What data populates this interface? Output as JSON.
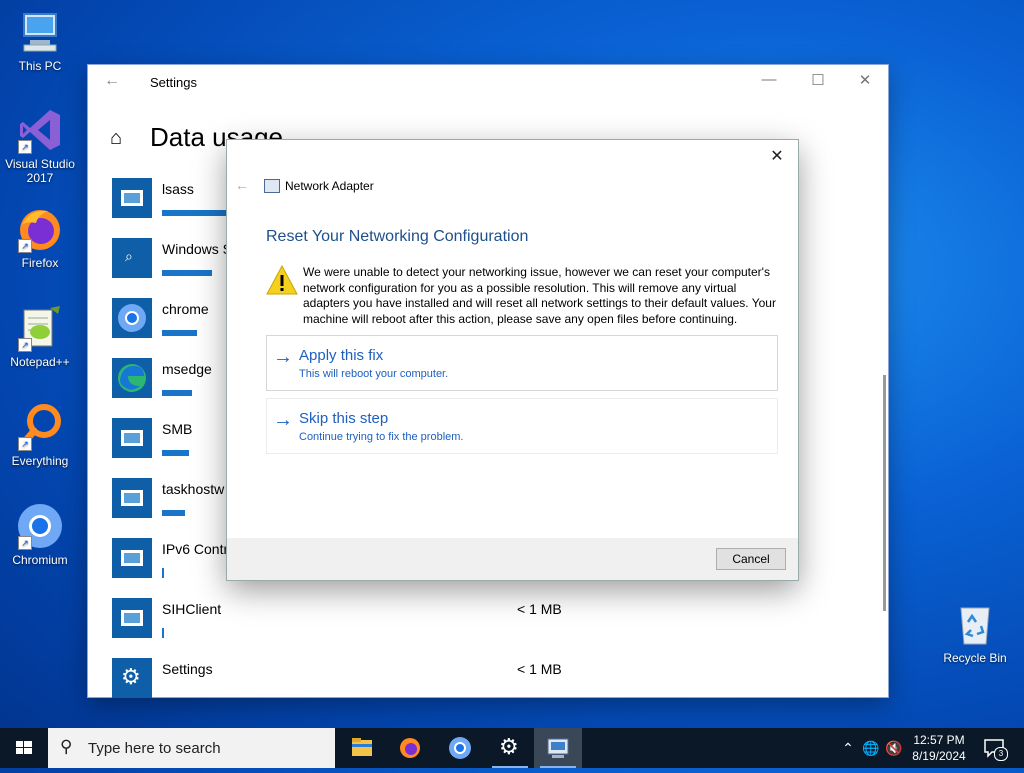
{
  "desktop": {
    "icons": [
      {
        "label": "This PC",
        "icon": "this-pc-icon"
      },
      {
        "label": "Visual Studio 2017",
        "icon": "visual-studio-icon"
      },
      {
        "label": "Firefox",
        "icon": "firefox-icon"
      },
      {
        "label": "Notepad++",
        "icon": "notepadpp-icon"
      },
      {
        "label": "Everything",
        "icon": "everything-icon"
      },
      {
        "label": "Chromium",
        "icon": "chromium-icon"
      }
    ],
    "recycle_bin": "Recycle Bin"
  },
  "settings": {
    "window_title": "Settings",
    "page_title": "Data usage",
    "apps": [
      {
        "name": "lsass",
        "size": "",
        "usage": 0.9
      },
      {
        "name": "Windows S",
        "size": "",
        "usage": 0.5
      },
      {
        "name": "chrome",
        "size": "",
        "usage": 0.35
      },
      {
        "name": "msedge",
        "size": "",
        "usage": 0.3
      },
      {
        "name": "SMB",
        "size": "",
        "usage": 0.27
      },
      {
        "name": "taskhostw",
        "size": "",
        "usage": 0.23
      },
      {
        "name": "IPv6 Contr",
        "size": "",
        "usage": 0.02
      },
      {
        "name": "SIHClient",
        "size": "< 1 MB",
        "usage": 0.02
      },
      {
        "name": "Settings",
        "size": "< 1 MB",
        "usage": 0.0
      }
    ]
  },
  "dialog": {
    "app_title": "Network Adapter",
    "heading": "Reset Your Networking Configuration",
    "message": "We were unable to detect your networking issue, however we can reset your computer's network configuration for you as a possible resolution. This will remove any virtual adapters you have installed and will reset all network settings to their default values. Your machine will reboot after this action, please save any open files before continuing.",
    "options": [
      {
        "title": "Apply this fix",
        "subtitle": "This will reboot your computer."
      },
      {
        "title": "Skip this step",
        "subtitle": "Continue trying to fix the problem."
      }
    ],
    "cancel_label": "Cancel"
  },
  "taskbar": {
    "search_placeholder": "Type here to search",
    "time": "12:57 PM",
    "date": "8/19/2024",
    "notification_count": "3"
  },
  "colors": {
    "accent": "#1a74c9",
    "link": "#1e5fc0",
    "heading": "#1e4f8c"
  }
}
